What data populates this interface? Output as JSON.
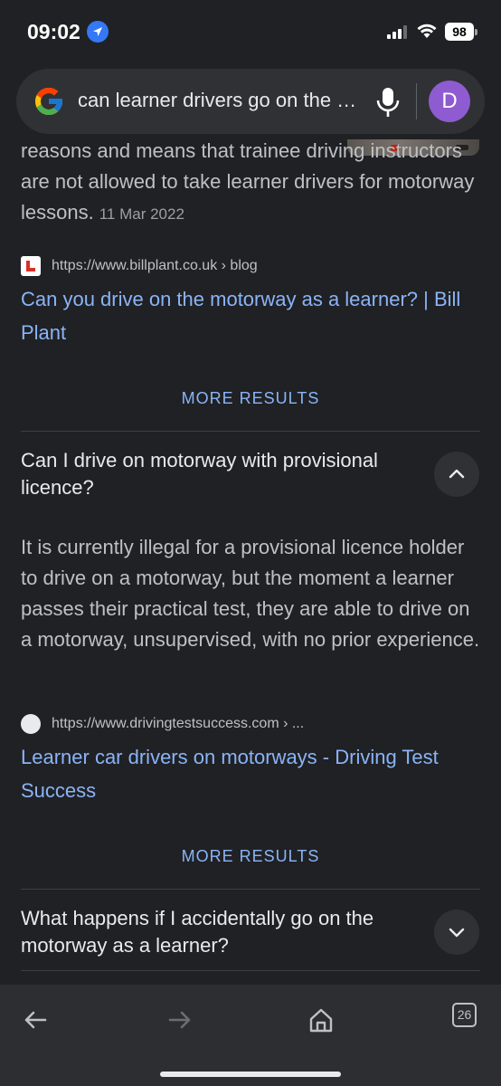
{
  "status_bar": {
    "time": "09:02",
    "battery": "98",
    "icons": [
      "location-arrow-icon",
      "signal-icon",
      "wifi-icon",
      "battery-icon"
    ]
  },
  "search": {
    "query": "can learner drivers go on the motorway",
    "avatar_letter": "D",
    "icons": [
      "google-g-icon",
      "microphone-icon"
    ]
  },
  "results": {
    "top_snippet": "reasons and means that trainee driving instructors are not allowed to take learner drivers for motorway lessons.",
    "top_snippet_date": "11 Mar 2022",
    "source1": {
      "url": "https://www.billplant.co.uk › blog",
      "title": "Can you drive on the motorway as a learner? | Bill Plant"
    },
    "more1": "MORE RESULTS",
    "question1": {
      "text": "Can I drive on motorway with provisional licence?",
      "answer": "It is currently illegal for a provisional licence holder to drive on a motorway, but the moment a learner passes their practical test, they are able to drive on a motorway, unsupervised, with no prior experience."
    },
    "source2": {
      "url": "https://www.drivingtestsuccess.com › ...",
      "title": "Learner car drivers on motorways - Driving Test Success"
    },
    "more2": "MORE RESULTS",
    "question2": {
      "text": "What happens if I accidentally go on the motorway as a learner?"
    }
  },
  "toolbar": {
    "tab_count": "26",
    "icons": [
      "back-arrow-icon",
      "forward-arrow-icon",
      "home-icon",
      "tabs-icon"
    ]
  },
  "colors": {
    "background": "#202124",
    "link": "#8ab4f8",
    "text": "#e8eaed",
    "avatar": "#8e5bd0"
  }
}
